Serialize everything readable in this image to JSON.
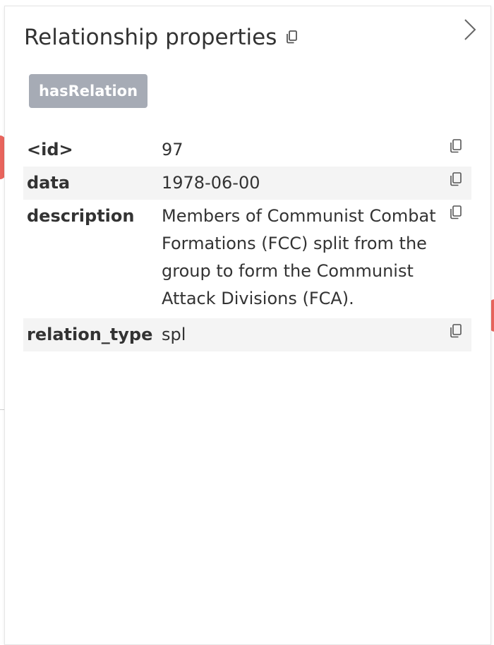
{
  "panel": {
    "title": "Relationship properties",
    "title_copy_icon": "copy-icon",
    "collapse_icon": "chevron-right-icon"
  },
  "relationship": {
    "type_label": "hasRelation",
    "type_color": "#a6abb5"
  },
  "properties": [
    {
      "key": "<id>",
      "value": "97"
    },
    {
      "key": "data",
      "value": "1978-06-00"
    },
    {
      "key": "description",
      "value": "Members of Communist Combat Formations (FCC) split from the group to form the Communist Attack Divisions (FCA)."
    },
    {
      "key": "relation_type",
      "value": "spl"
    }
  ],
  "colors": {
    "row_alt_bg": "#f4f4f4",
    "text": "#333333",
    "node_red": "#e9655d"
  }
}
